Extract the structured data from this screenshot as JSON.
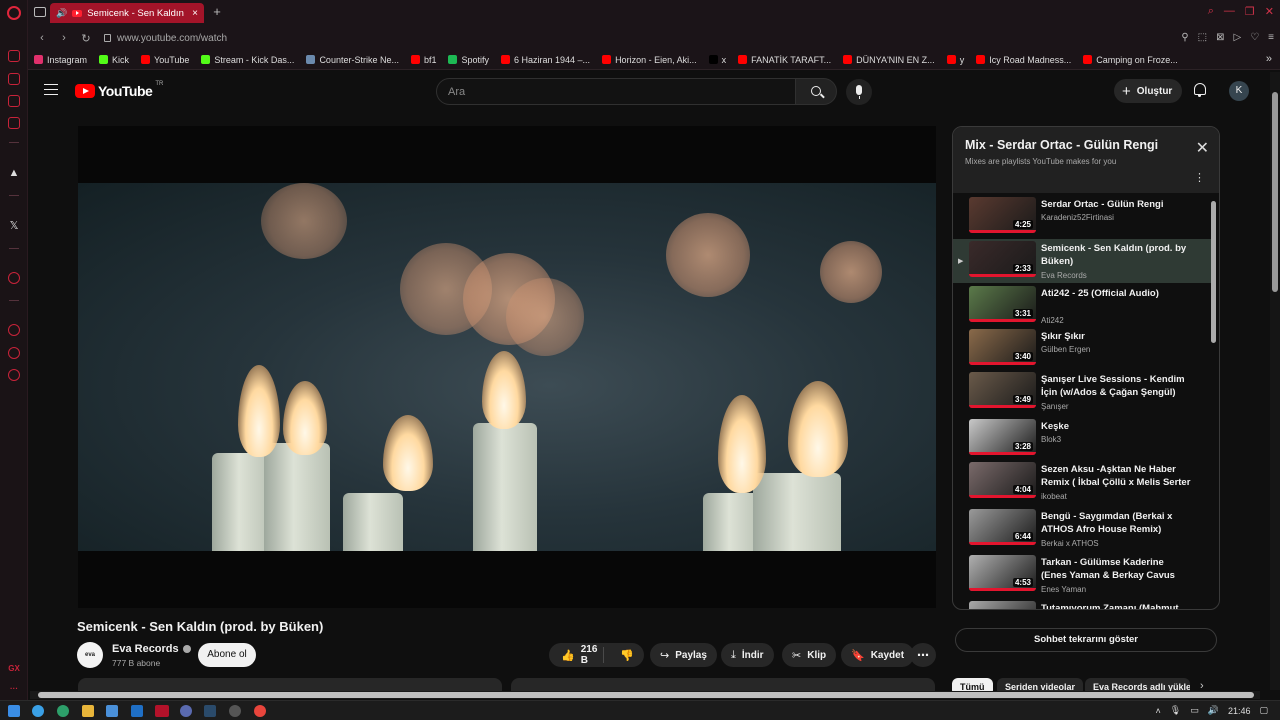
{
  "browser": {
    "tab_title": "Semicenk - Sen Kaldın",
    "url": "www.youtube.com/watch",
    "gx_label": "GX",
    "bookmarks": [
      {
        "label": "Instagram",
        "color": "#e1306c"
      },
      {
        "label": "Kick",
        "color": "#53fc18"
      },
      {
        "label": "YouTube",
        "color": "#ff0000"
      },
      {
        "label": "Stream - Kick Das...",
        "color": "#53fc18"
      },
      {
        "label": "Counter-Strike Ne...",
        "color": "#6b8aad"
      },
      {
        "label": "bf1",
        "color": "#ff0000"
      },
      {
        "label": "Spotify",
        "color": "#1db954"
      },
      {
        "label": "6 Haziran 1944 –...",
        "color": "#ff0000"
      },
      {
        "label": "Horizon - Eien, Aki...",
        "color": "#ff0000"
      },
      {
        "label": "x",
        "color": "#000000"
      },
      {
        "label": "FANATİK TARAFT...",
        "color": "#ff0000"
      },
      {
        "label": "DÜNYA'NIN EN Z...",
        "color": "#ff0000"
      },
      {
        "label": "y",
        "color": "#ff0000"
      },
      {
        "label": "Icy Road Madness...",
        "color": "#ff0000"
      },
      {
        "label": "Camping on Froze...",
        "color": "#ff0000"
      }
    ]
  },
  "header": {
    "logo_text": "YouTube",
    "logo_region": "TR",
    "search_placeholder": "Ara",
    "create_label": "Oluştur",
    "avatar_letter": "K"
  },
  "video": {
    "title": "Semicenk - Sen Kaldın (prod. by Büken)",
    "channel": "Eva Records",
    "channel_avatar_text": "eva",
    "subscribers": "777 B abone",
    "subscribe_label": "Abone ol",
    "likes": "216 B",
    "share_label": "Paylaş",
    "download_label": "İndir",
    "clip_label": "Klip",
    "save_label": "Kaydet"
  },
  "playlist": {
    "title": "Mix - Serdar Ortac - Gülün Rengi",
    "subtitle": "Mixes are playlists YouTube makes for you",
    "items": [
      {
        "title": "Serdar Ortac - Gülün Rengi",
        "artist": "Karadeniz52Firtinasi",
        "duration": "4:25",
        "thumb": "#5a3a30"
      },
      {
        "title": "Semicenk - Sen Kaldın (prod. by Büken)",
        "artist": "Eva Records",
        "duration": "2:33",
        "thumb": "#3a2a2a"
      },
      {
        "title": "Ati242 - 25 (Official Audio)",
        "artist": "Ati242",
        "duration": "3:31",
        "thumb": "#5b7a4a"
      },
      {
        "title": "Şıkır Şıkır",
        "artist": "Gülben Ergen",
        "duration": "3:40",
        "thumb": "#8a6a4a"
      },
      {
        "title": "Şanışer Live Sessions - Kendim İçin (w/Ados & Çağan Şengül)",
        "artist": "Şanışer",
        "duration": "3:49",
        "thumb": "#6a5a4a"
      },
      {
        "title": "Keşke",
        "artist": "Blok3",
        "duration": "3:28",
        "thumb": "#c9c9c9"
      },
      {
        "title": "Sezen Aksu -Aşktan Ne Haber Remix ( İkbal Çöllü x Melis Serter )",
        "artist": "ikobeat",
        "duration": "4:04",
        "thumb": "#7a6a6a"
      },
      {
        "title": "Bengü - Saygımdan (Berkai x ATHOS Afro House Remix)",
        "artist": "Berkai x ATHOS",
        "duration": "6:44",
        "thumb": "#9a9a9a"
      },
      {
        "title": "Tarkan - Gülümse Kaderine (Enes Yaman & Berkay Cavus Remix)",
        "artist": "Enes Yaman",
        "duration": "4:53",
        "thumb": "#b0b0b0"
      },
      {
        "title": "Tutamıyorum Zamanı (Mahmut Orhan Remix)",
        "artist": "",
        "duration": "",
        "thumb": "#aaaaaa"
      }
    ]
  },
  "chat": {
    "label": "Sohbet tekrarını göster"
  },
  "chips": [
    {
      "label": "Tümü"
    },
    {
      "label": "Seriden videolar"
    },
    {
      "label": "Eva Records adlı yüklemeler"
    }
  ],
  "taskbar": {
    "time": "21:46"
  }
}
